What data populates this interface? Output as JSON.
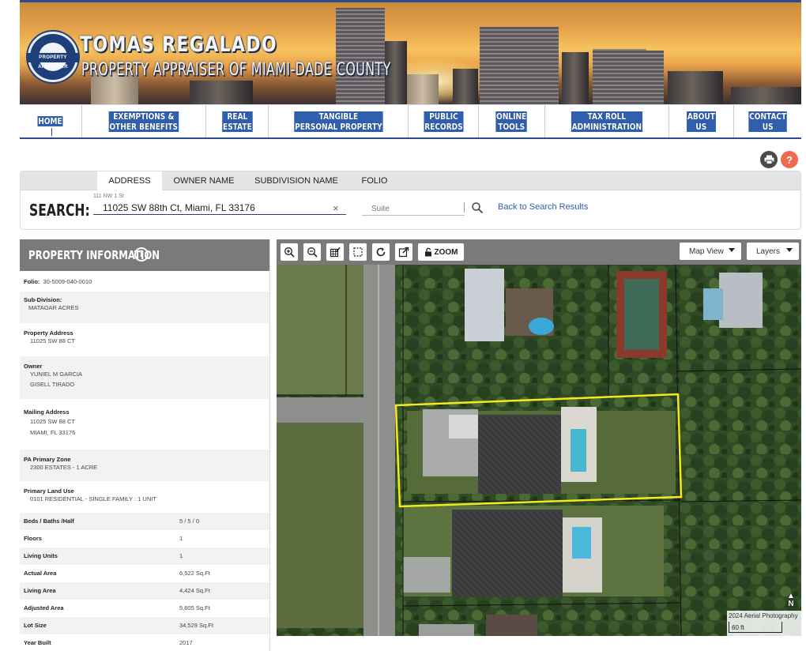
{
  "banner": {
    "title": "TOMAS REGALADO",
    "subtitle": "PROPERTY APPRAISER OF MIAMI-DADE COUNTY",
    "seal_text_top": "TOMAS REGALADO",
    "seal_text_band": "PROPERTY APPRAISER",
    "seal_text_bottom": "MIAMI-DADE COUNTY"
  },
  "nav": {
    "items": [
      {
        "label": "HOME",
        "active": true
      },
      {
        "label": "EXEMPTIONS &\nOTHER BENEFITS"
      },
      {
        "label": "REAL\nESTATE"
      },
      {
        "label": "TANGIBLE\nPERSONAL PROPERTY"
      },
      {
        "label": "PUBLIC\nRECORDS"
      },
      {
        "label": "ONLINE\nTOOLS"
      },
      {
        "label": "TAX ROLL\nADMINISTRATION"
      },
      {
        "label": "ABOUT\nUS"
      },
      {
        "label": "CONTACT\nUS"
      }
    ]
  },
  "utility": {
    "print_icon": "printer-icon",
    "help_label": "?"
  },
  "search": {
    "tabs": [
      {
        "label": "ADDRESS",
        "active": true
      },
      {
        "label": "OWNER NAME"
      },
      {
        "label": "SUBDIVISION NAME"
      },
      {
        "label": "FOLIO"
      }
    ],
    "label": "SEARCH:",
    "address_hint": "111 NW 1 St",
    "address_value": "11025 SW 88th Ct, Miami, FL 33176",
    "clear_label": "×",
    "suite_placeholder": "Suite",
    "back_link": "Back to Search Results"
  },
  "property": {
    "title": "PROPERTY INFORMATION",
    "info_icon_label": "i",
    "folio_label": "Folio:",
    "folio_value": "30-5009-040-0010",
    "subdivision_label": "Sub-Division:",
    "subdivision_value": "MATAGAR ACRES",
    "address_label": "Property Address",
    "address_value": "11025 SW 88 CT",
    "owner_label": "Owner",
    "owner_lines": [
      "YUNIEL M GARCIA",
      "GISELL TIRADO"
    ],
    "mailing_label": "Mailing Address",
    "mailing_lines": [
      "11025 SW 88 CT",
      "MIAMI, FL 33176"
    ],
    "zone_label": "PA Primary Zone",
    "zone_value": "2300 ESTATES - 1 ACRE",
    "land_use_label": "Primary Land Use",
    "land_use_value": "0101 RESIDENTIAL - SINGLE FAMILY : 1 UNIT",
    "facts": [
      {
        "label": "Beds / Baths /Half",
        "value": "5 / 5 / 0"
      },
      {
        "label": "Floors",
        "value": "1"
      },
      {
        "label": "Living Units",
        "value": "1"
      },
      {
        "label": "Actual Area",
        "value": "6,522 Sq.Ft"
      },
      {
        "label": "Living Area",
        "value": "4,424 Sq.Ft"
      },
      {
        "label": "Adjusted Area",
        "value": "5,605 Sq.Ft"
      },
      {
        "label": "Lot Size",
        "value": "34,529 Sq.Ft"
      },
      {
        "label": "Year Built",
        "value": "2017"
      }
    ]
  },
  "map": {
    "zoom_label": "ZOOM",
    "map_view_label": "Map View",
    "layers_label": "Layers",
    "aerial_label": "2024 Aerial Photography",
    "scale_label": "60 ft",
    "north_label": "N",
    "tools": [
      "zoom-in-icon",
      "zoom-out-icon",
      "measure-icon",
      "select-area-icon",
      "refresh-icon",
      "external-link-icon"
    ],
    "highlight_color": "#f2ea1f"
  }
}
